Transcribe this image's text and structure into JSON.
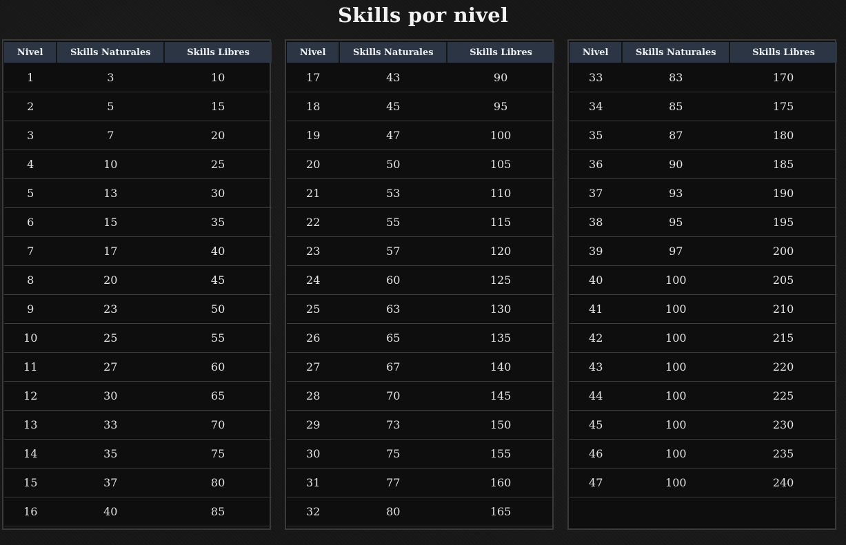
{
  "page": {
    "title": "Skills por nivel"
  },
  "columns": {
    "nivel": "Nivel",
    "naturales": "Skills Naturales",
    "libres": "Skills Libres"
  },
  "tables": [
    {
      "rows": [
        {
          "nivel": "1",
          "naturales": "3",
          "libres": "10"
        },
        {
          "nivel": "2",
          "naturales": "5",
          "libres": "15"
        },
        {
          "nivel": "3",
          "naturales": "7",
          "libres": "20"
        },
        {
          "nivel": "4",
          "naturales": "10",
          "libres": "25"
        },
        {
          "nivel": "5",
          "naturales": "13",
          "libres": "30"
        },
        {
          "nivel": "6",
          "naturales": "15",
          "libres": "35"
        },
        {
          "nivel": "7",
          "naturales": "17",
          "libres": "40"
        },
        {
          "nivel": "8",
          "naturales": "20",
          "libres": "45"
        },
        {
          "nivel": "9",
          "naturales": "23",
          "libres": "50"
        },
        {
          "nivel": "10",
          "naturales": "25",
          "libres": "55"
        },
        {
          "nivel": "11",
          "naturales": "27",
          "libres": "60"
        },
        {
          "nivel": "12",
          "naturales": "30",
          "libres": "65"
        },
        {
          "nivel": "13",
          "naturales": "33",
          "libres": "70"
        },
        {
          "nivel": "14",
          "naturales": "35",
          "libres": "75"
        },
        {
          "nivel": "15",
          "naturales": "37",
          "libres": "80"
        },
        {
          "nivel": "16",
          "naturales": "40",
          "libres": "85"
        }
      ]
    },
    {
      "rows": [
        {
          "nivel": "17",
          "naturales": "43",
          "libres": "90"
        },
        {
          "nivel": "18",
          "naturales": "45",
          "libres": "95"
        },
        {
          "nivel": "19",
          "naturales": "47",
          "libres": "100"
        },
        {
          "nivel": "20",
          "naturales": "50",
          "libres": "105"
        },
        {
          "nivel": "21",
          "naturales": "53",
          "libres": "110"
        },
        {
          "nivel": "22",
          "naturales": "55",
          "libres": "115"
        },
        {
          "nivel": "23",
          "naturales": "57",
          "libres": "120"
        },
        {
          "nivel": "24",
          "naturales": "60",
          "libres": "125"
        },
        {
          "nivel": "25",
          "naturales": "63",
          "libres": "130"
        },
        {
          "nivel": "26",
          "naturales": "65",
          "libres": "135"
        },
        {
          "nivel": "27",
          "naturales": "67",
          "libres": "140"
        },
        {
          "nivel": "28",
          "naturales": "70",
          "libres": "145"
        },
        {
          "nivel": "29",
          "naturales": "73",
          "libres": "150"
        },
        {
          "nivel": "30",
          "naturales": "75",
          "libres": "155"
        },
        {
          "nivel": "31",
          "naturales": "77",
          "libres": "160"
        },
        {
          "nivel": "32",
          "naturales": "80",
          "libres": "165"
        }
      ]
    },
    {
      "rows": [
        {
          "nivel": "33",
          "naturales": "83",
          "libres": "170"
        },
        {
          "nivel": "34",
          "naturales": "85",
          "libres": "175"
        },
        {
          "nivel": "35",
          "naturales": "87",
          "libres": "180"
        },
        {
          "nivel": "36",
          "naturales": "90",
          "libres": "185"
        },
        {
          "nivel": "37",
          "naturales": "93",
          "libres": "190"
        },
        {
          "nivel": "38",
          "naturales": "95",
          "libres": "195"
        },
        {
          "nivel": "39",
          "naturales": "97",
          "libres": "200"
        },
        {
          "nivel": "40",
          "naturales": "100",
          "libres": "205"
        },
        {
          "nivel": "41",
          "naturales": "100",
          "libres": "210"
        },
        {
          "nivel": "42",
          "naturales": "100",
          "libres": "215"
        },
        {
          "nivel": "43",
          "naturales": "100",
          "libres": "220"
        },
        {
          "nivel": "44",
          "naturales": "100",
          "libres": "225"
        },
        {
          "nivel": "45",
          "naturales": "100",
          "libres": "230"
        },
        {
          "nivel": "46",
          "naturales": "100",
          "libres": "235"
        },
        {
          "nivel": "47",
          "naturales": "100",
          "libres": "240"
        }
      ]
    }
  ]
}
